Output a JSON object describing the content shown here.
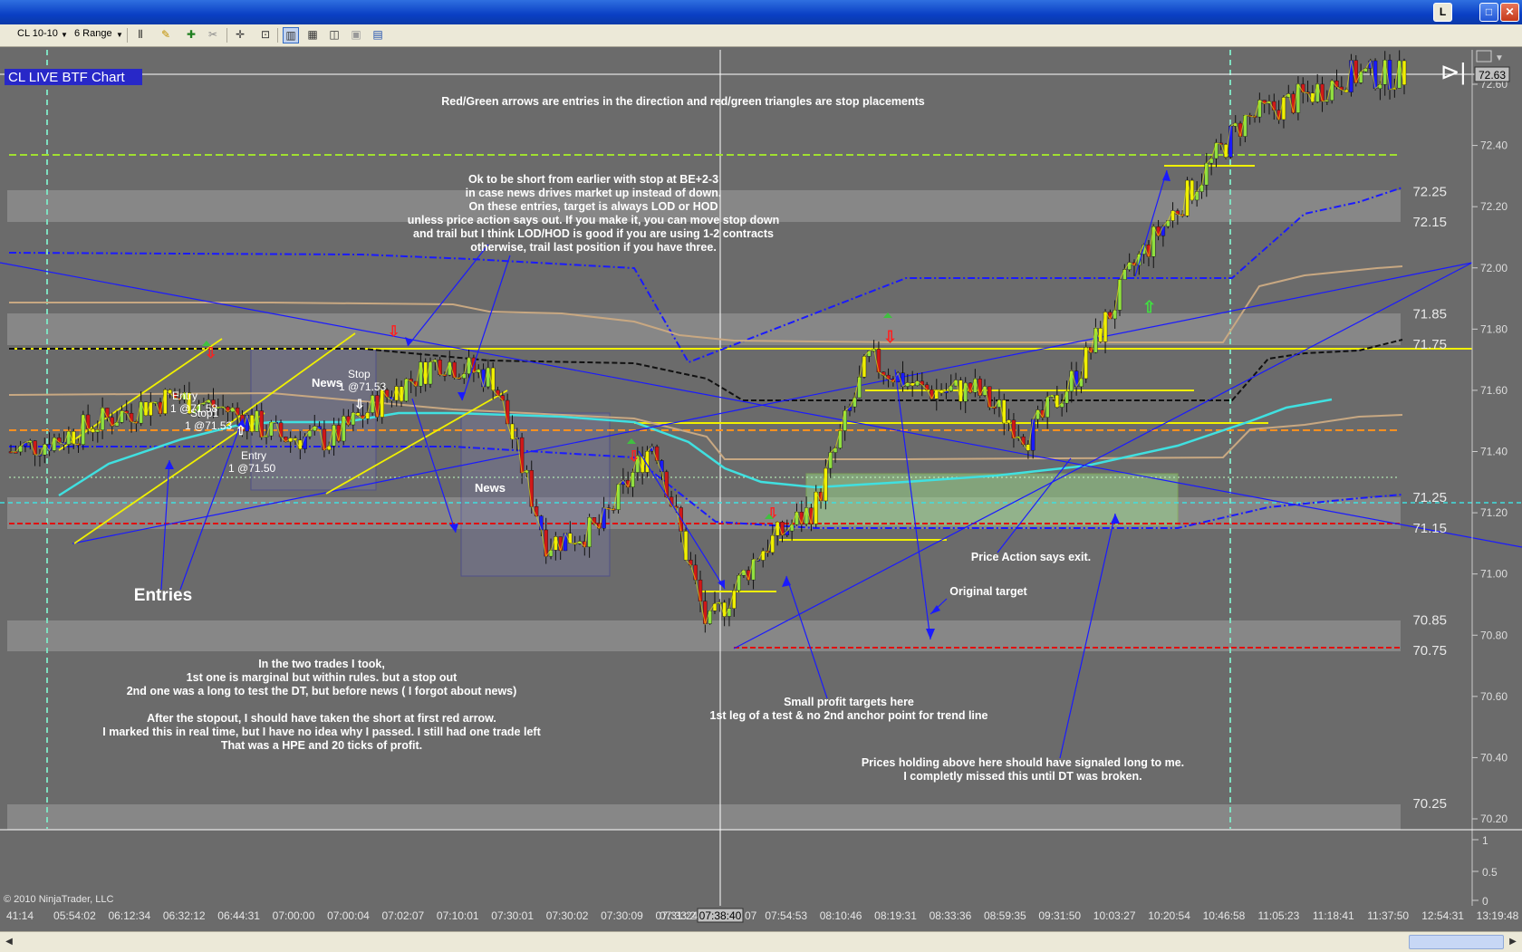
{
  "window": {
    "min_label": "L",
    "max_glyph": "□",
    "close_glyph": "✕"
  },
  "toolbar": {
    "instrument": "CL 10-10",
    "interval": "6 Range",
    "icons": [
      "bars-icon",
      "pencil-icon",
      "plus-icon",
      "scissors-icon",
      "crosshair-icon",
      "zoom-icon",
      "chart-style-1-icon",
      "chart-style-2-icon",
      "chart-style-3-icon",
      "properties-icon",
      "data-box-icon"
    ]
  },
  "chart_title": "CL LIVE BTF Chart",
  "copyright": "© 2010 NinjaTrader, LLC",
  "current_price": "72.63",
  "crosshair_time": "07:38:40",
  "annotations": {
    "header": "Red/Green arrows are entries in the direction and red/green triangles are stop placements",
    "short_note": [
      "Ok to be short from earlier with stop at BE+2-3",
      "in case news drives market up instead of down.",
      "On these entries, target is always LOD or HOD",
      "unless price action says out. If you make it, you can move stop down",
      "and trail but I think LOD/HOD is good if you are using 1-2 contracts",
      "otherwise, trail last position if you have three."
    ],
    "entries": "Entries",
    "news1": "News",
    "news2": "News",
    "stop1": "Stop",
    "stop1_price": "1 @71.53",
    "entry1": "Entry",
    "entry1_price": "1 @71.58",
    "stop2": "Stop1",
    "stop2_price": "1 @71.53",
    "entry2": "Entry",
    "entry2_price": "1 @71.50",
    "trades_note": [
      "In the two trades I took,",
      "1st one is marginal but within rules. but a stop out",
      "2nd one was a long to test the DT, but before news ( I forgot about news)",
      "",
      "After the stopout, I should have taken the short at first red arrow.",
      "I marked this in real time, but I have no idea why I passed. I still had one trade left",
      "That was a HPE and 20 ticks of profit."
    ],
    "price_action": "Price Action says exit.",
    "original_target": "Original target",
    "small_profit": [
      "Small profit targets here",
      "1st leg of a test & no 2nd anchor point for trend line"
    ],
    "holding_note": [
      "Prices holding above here should have signaled long to me.",
      "I completly missed this until DT was broken."
    ]
  },
  "y_axis": {
    "ticks": [
      "72.60",
      "72.40",
      "72.20",
      "72.00",
      "71.80",
      "71.60",
      "71.40",
      "71.20",
      "71.00",
      "70.80",
      "70.60",
      "70.40",
      "70.20"
    ],
    "zone_labels": [
      "72.25",
      "72.15",
      "71.85",
      "71.75",
      "71.25",
      "71.15",
      "70.85",
      "70.75",
      "70.25"
    ]
  },
  "volume_axis": {
    "ticks": [
      "1",
      "0.5",
      "0"
    ]
  },
  "x_axis": {
    "ticks": [
      "41:14",
      "05:54:02",
      "06:12:34",
      "06:32:12",
      "06:44:31",
      "07:00:00",
      "07:00:04",
      "07:02:07",
      "07:10:01",
      "07:30:01",
      "07:30:02",
      "07:30:09",
      "07:31:24",
      "07:33:2",
      "07:54:53",
      "08:10:46",
      "08:19:31",
      "08:33:36",
      "08:59:35",
      "09:31:50",
      "10:03:27",
      "10:20:54",
      "10:46:58",
      "11:05:23",
      "11:18:41",
      "11:37:50",
      "12:54:31",
      "13:19:48"
    ],
    "crosshair_suffix": "07"
  },
  "colors": {
    "background": "#6b6b6b",
    "zone": "#8c8c8c",
    "yellow": "#f0f000",
    "cyan": "#40e0d0",
    "blue": "#1414c8",
    "tan": "#c8a882",
    "red": "#e01010",
    "green": "#90e040"
  },
  "chart_data": {
    "type": "line",
    "title": "CL LIVE BTF Chart",
    "instrument": "CL 10-10",
    "bar_type": "6 Range",
    "x": [
      "05:41:14",
      "05:54:02",
      "06:12:34",
      "06:32:12",
      "06:44:31",
      "07:00:00",
      "07:00:04",
      "07:02:07",
      "07:10:01",
      "07:30:01",
      "07:30:02",
      "07:30:09",
      "07:31:24",
      "07:33:2",
      "07:54:53",
      "08:10:46",
      "08:19:31",
      "08:33:36",
      "08:59:35",
      "09:31:50",
      "10:03:27",
      "10:20:54",
      "10:46:58",
      "11:05:23",
      "11:18:41",
      "11:37:50",
      "12:54:31"
    ],
    "series": [
      {
        "values": [
          71.4,
          71.45,
          71.52,
          71.58,
          71.54,
          71.45,
          71.44,
          71.58,
          71.7,
          71.64,
          71.1,
          71.15,
          71.44,
          70.82,
          71.08,
          71.22,
          71.7,
          71.6,
          71.6,
          71.45,
          71.68,
          72.02,
          72.25,
          72.48,
          72.55,
          72.63,
          72.63
        ]
      }
    ],
    "ylim": [
      70.2,
      72.66
    ],
    "y_ticks": [
      72.6,
      72.4,
      72.2,
      72.0,
      71.8,
      71.6,
      71.4,
      71.2,
      71.0,
      70.8,
      70.6,
      70.4,
      70.2
    ],
    "zones": [
      [
        72.25,
        72.15
      ],
      [
        71.85,
        71.75
      ],
      [
        71.25,
        71.15
      ],
      [
        70.85,
        70.75
      ],
      [
        70.25,
        70.2
      ]
    ],
    "last_price": 72.63,
    "grid": false
  }
}
